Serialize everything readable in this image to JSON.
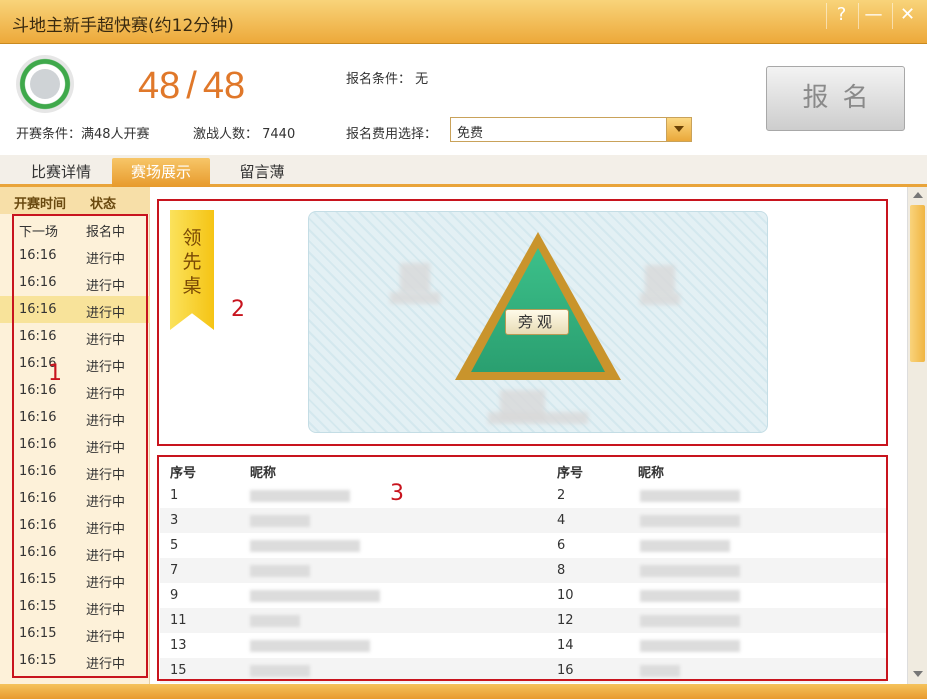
{
  "window": {
    "title": "斗地主新手超快赛(约12分钟)",
    "help": "?",
    "minimize": "—",
    "close": "✕"
  },
  "header": {
    "count_current": "48",
    "count_sep": "/",
    "count_total": "48",
    "signup_condition": "报名条件：  无",
    "start_condition": "开赛条件：满48人开赛",
    "players": "激战人数：  7440",
    "fee_label": "报名费用选择：",
    "fee_value": "免费",
    "signup_button": "报名"
  },
  "tabs": [
    {
      "label": "比赛详情"
    },
    {
      "label": "赛场展示"
    },
    {
      "label": "留言薄"
    }
  ],
  "sidebar": {
    "col_time": "开赛时间",
    "col_status": "状态",
    "rows": [
      {
        "time": "下一场",
        "status": "报名中"
      },
      {
        "time": "16:16",
        "status": "进行中"
      },
      {
        "time": "16:16",
        "status": "进行中"
      },
      {
        "time": "16:16",
        "status": "进行中"
      },
      {
        "time": "16:16",
        "status": "进行中"
      },
      {
        "time": "16:16",
        "status": "进行中"
      },
      {
        "time": "16:16",
        "status": "进行中"
      },
      {
        "time": "16:16",
        "status": "进行中"
      },
      {
        "time": "16:16",
        "status": "进行中"
      },
      {
        "time": "16:16",
        "status": "进行中"
      },
      {
        "time": "16:16",
        "status": "进行中"
      },
      {
        "time": "16:16",
        "status": "进行中"
      },
      {
        "time": "16:16",
        "status": "进行中"
      },
      {
        "time": "16:15",
        "status": "进行中"
      },
      {
        "time": "16:15",
        "status": "进行中"
      },
      {
        "time": "16:15",
        "status": "进行中"
      },
      {
        "time": "16:15",
        "status": "进行中"
      }
    ]
  },
  "showcase": {
    "banner": "领先桌",
    "watch_button": "旁观"
  },
  "player_list": {
    "col_index": "序号",
    "col_nick": "昵称",
    "rows": [
      {
        "left": "1",
        "right": "2"
      },
      {
        "left": "3",
        "right": "4"
      },
      {
        "left": "5",
        "right": "6"
      },
      {
        "left": "7",
        "right": "8"
      },
      {
        "left": "9",
        "right": "10"
      },
      {
        "left": "11",
        "right": "12"
      },
      {
        "left": "13",
        "right": "14"
      },
      {
        "left": "15",
        "right": "16"
      }
    ]
  },
  "annotations": {
    "label_1": "1",
    "label_2": "2",
    "label_3": "3"
  },
  "colors": {
    "accent": "#e9a43a",
    "count": "#e0782a",
    "annotation": "#c8141e",
    "table_green": "#2a9f70"
  },
  "icons": {
    "avatar": "users-icon",
    "dropdown": "chevron-down-icon"
  }
}
